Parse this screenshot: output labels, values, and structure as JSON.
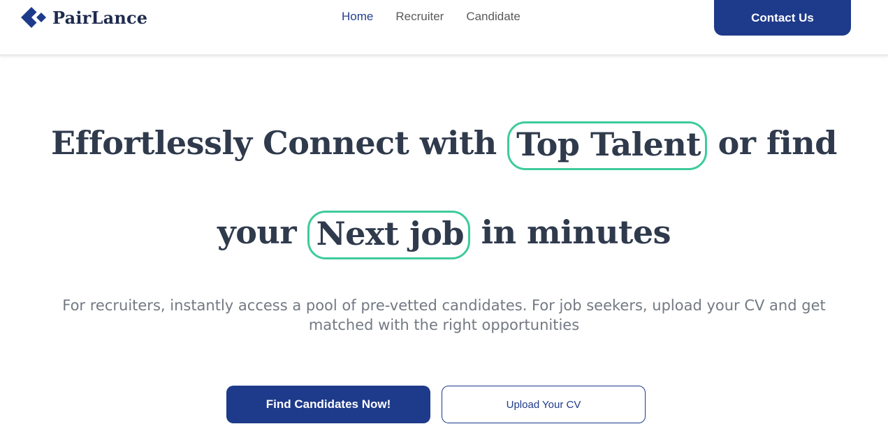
{
  "brand": {
    "name": "PairLance",
    "icon": "diamond-logo-icon",
    "color": "#1e3a8a"
  },
  "nav": {
    "items": [
      {
        "label": "Home",
        "active": true
      },
      {
        "label": "Recruiter",
        "active": false
      },
      {
        "label": "Candidate",
        "active": false
      }
    ],
    "contact_label": "Contact Us"
  },
  "hero": {
    "line1_before": "Effortlessly Connect with ",
    "line1_highlight": "Top Talent",
    "line1_after": " or find",
    "line2_before": "your ",
    "line2_highlight": "Next job",
    "line2_after": " in minutes",
    "highlight_color": "#3ecb9a",
    "subtitle_line1": "For recruiters, instantly access a pool of pre-vetted candidates. For job seekers, upload your CV and get",
    "subtitle_line2": "matched with the right opportunities"
  },
  "cta": {
    "primary_label": "Find Candidates Now!",
    "secondary_label": "Upload Your CV"
  }
}
